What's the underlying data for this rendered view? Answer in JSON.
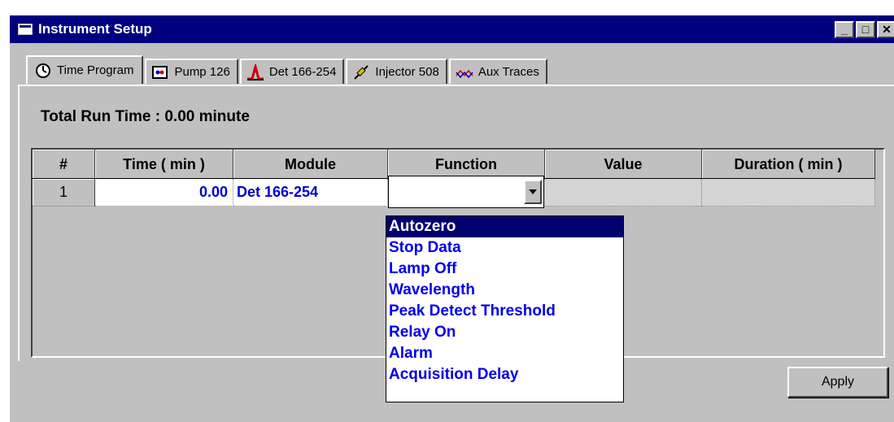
{
  "window": {
    "title": "Instrument Setup",
    "min_label": "_",
    "max_label": "□",
    "close_label": "X"
  },
  "tabs": [
    {
      "label": "Time Program",
      "icon": "clock-icon",
      "active": true
    },
    {
      "label": "Pump 126",
      "icon": "pump-icon",
      "active": false
    },
    {
      "label": "Det 166-254",
      "icon": "detector-peak-icon",
      "active": false
    },
    {
      "label": "Injector 508",
      "icon": "injector-icon",
      "active": false
    },
    {
      "label": "Aux Traces",
      "icon": "aux-traces-icon",
      "active": false
    }
  ],
  "run_time": {
    "text": "Total Run Time :  0.00  minute"
  },
  "table": {
    "headers": [
      "#",
      "Time ( min )",
      "Module",
      "Function",
      "Value",
      "Duration ( min )"
    ],
    "rows": [
      {
        "num": "1",
        "time": "0.00",
        "module": "Det 166-254",
        "function": "",
        "value": "",
        "duration": ""
      }
    ]
  },
  "dropdown": {
    "options": [
      "Autozero",
      "Stop Data",
      "Lamp Off",
      "Wavelength",
      "Peak Detect Threshold",
      "Relay On",
      "Alarm",
      "Acquisition Delay"
    ],
    "highlighted": "Autozero"
  },
  "apply_label": "Apply",
  "colors": {
    "titlebar": "#000080",
    "value_text": "#0000cc",
    "highlight": "#00006e"
  }
}
